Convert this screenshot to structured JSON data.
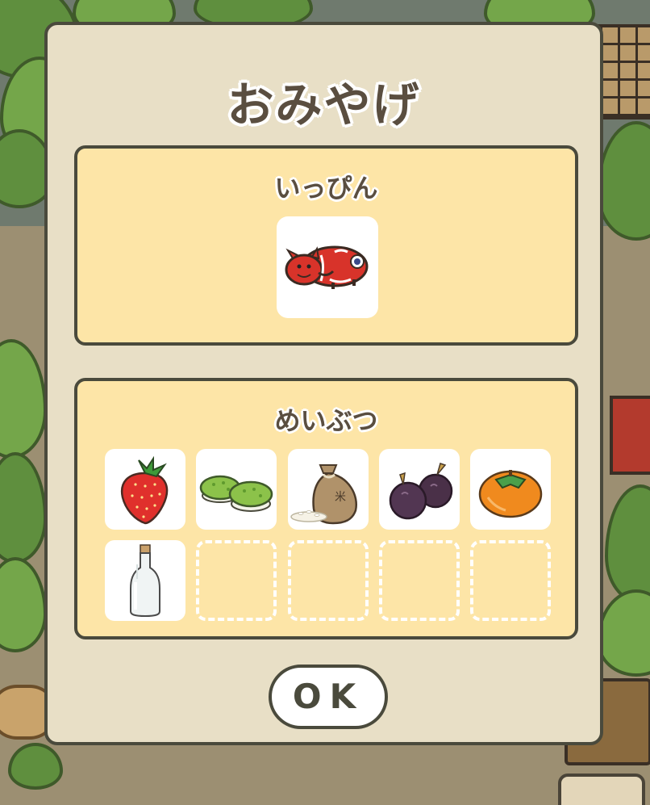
{
  "dialog": {
    "title": "おみやげ",
    "specialty_section": {
      "title": "いっぴん",
      "items": [
        {
          "icon": "red-cow-toy-icon"
        }
      ]
    },
    "local_section": {
      "title": "めいぶつ",
      "items": [
        {
          "icon": "strawberry-icon"
        },
        {
          "icon": "green-mochi-icon"
        },
        {
          "icon": "rice-bag-icon",
          "bag_label": "米"
        },
        {
          "icon": "grapes-icon"
        },
        {
          "icon": "persimmon-icon"
        },
        {
          "icon": "glass-bottle-icon"
        },
        {
          "icon": "empty-slot"
        },
        {
          "icon": "empty-slot"
        },
        {
          "icon": "empty-slot"
        },
        {
          "icon": "empty-slot"
        }
      ]
    },
    "ok_label": "OK"
  },
  "colors": {
    "dialog_bg": "#e8dfc6",
    "panel_bg": "#fde5a7",
    "border": "#4a4a3c",
    "title_text": "#5a4e40"
  }
}
